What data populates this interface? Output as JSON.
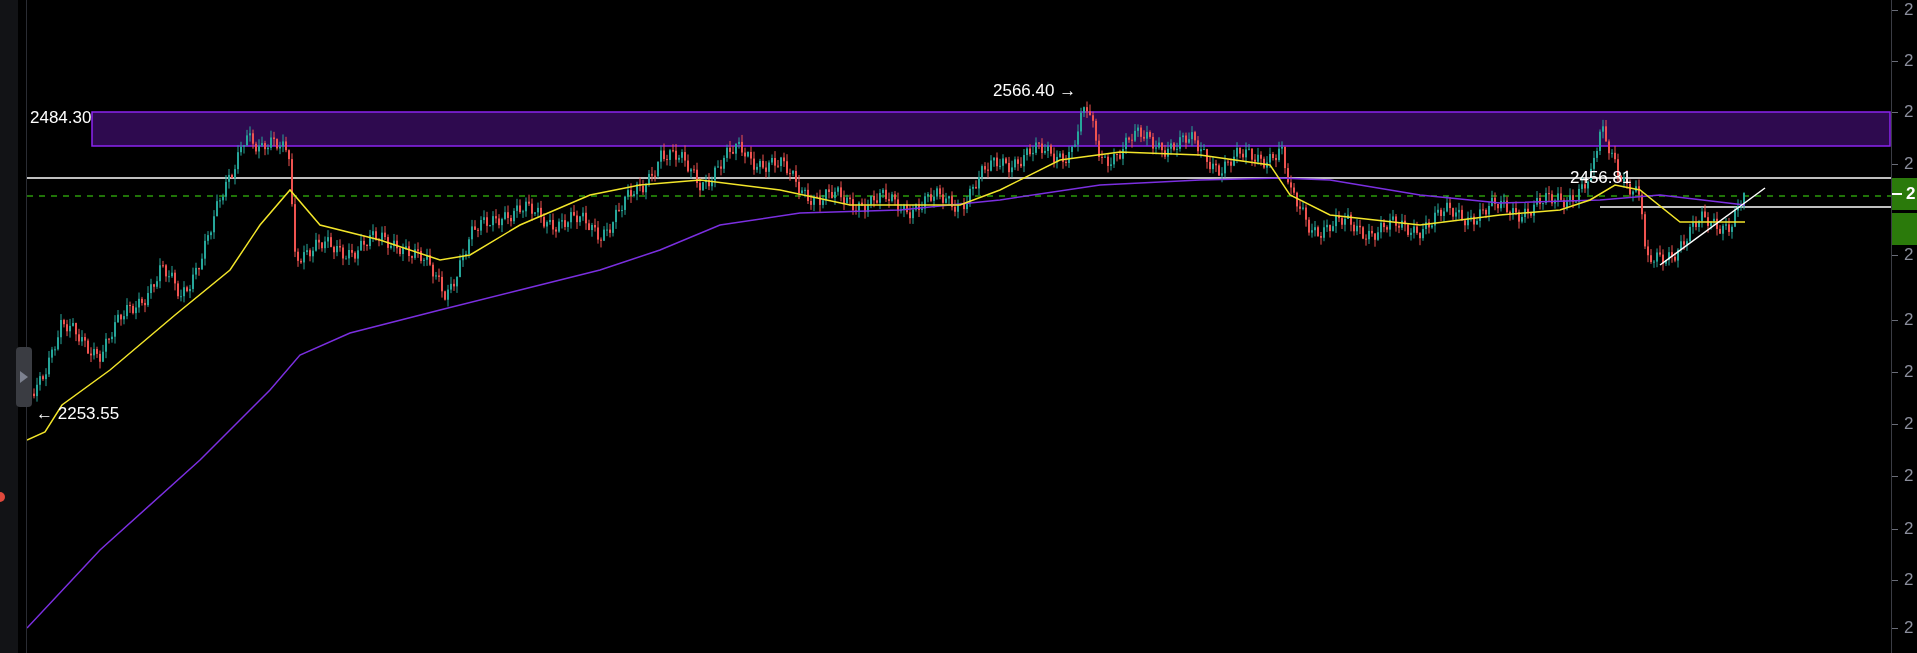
{
  "chart": {
    "price_labels": [
      {
        "text": "2484.30"
      },
      {
        "text": "2566.40 →"
      },
      {
        "text": "← 2253.55"
      },
      {
        "text": "2456.81"
      }
    ]
  },
  "price_axis": {
    "ticks": [
      "2",
      "2",
      "2",
      "2",
      "2",
      "2",
      "2",
      "2",
      "2",
      "2",
      "2",
      "2"
    ],
    "current_price": "2"
  }
}
